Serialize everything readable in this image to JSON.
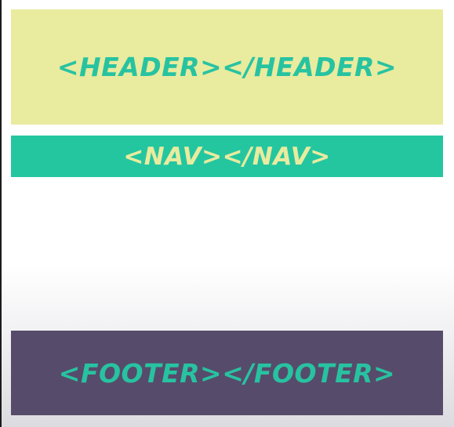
{
  "layout_blocks": {
    "header": {
      "text": "<HEADER></HEADER>",
      "background": "#e9eb9f",
      "text_color": "#27c3a1"
    },
    "nav": {
      "text": "<NAV></NAV>",
      "background": "#24c6a0",
      "text_color": "#e9eb9f"
    },
    "footer": {
      "text": "<FOOTER></FOOTER>",
      "background": "#574b6b",
      "text_color": "#27c3a1"
    }
  }
}
